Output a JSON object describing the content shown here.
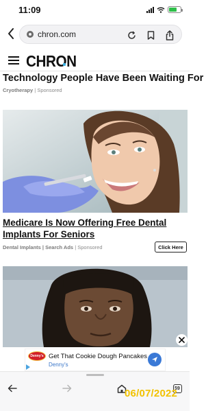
{
  "status_bar": {
    "time": "11:09",
    "battery_level": 0.7
  },
  "browser": {
    "url": "chron.com"
  },
  "site": {
    "logo_text": "CHRON",
    "accent_color": "#3ab0e2"
  },
  "ad1": {
    "headline": "Technology People Have Been Waiting For",
    "source": "Cryotherapy",
    "sponsored": "Sponsored"
  },
  "ad2": {
    "headline": "Medicare Is Now Offering Free Dental Implants For Seniors",
    "source": "Dental Implants | Search Ads",
    "sponsored": "Sponsored",
    "cta": "Click Here"
  },
  "banner_ad": {
    "logo_text": "Denny's",
    "title": "Get That Cookie Dough Pancakes",
    "subtitle": "Denny's"
  },
  "toolbar": {
    "tab_count": "59"
  },
  "overlay": {
    "date_stamp": "06/07/2022"
  }
}
